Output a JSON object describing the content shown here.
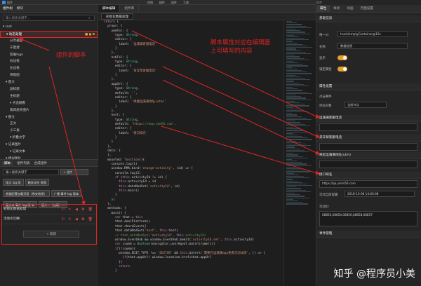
{
  "topbar": {
    "logo_text": "插件",
    "menu": [
      "在线",
      "插件",
      "组件",
      "工具"
    ],
    "right_text": "同步"
  },
  "left": {
    "tabs": [
      "组件树",
      "模块"
    ],
    "search_placeholder": "输入搜索关键字...",
    "tree": [
      {
        "label": "▾ root",
        "indent": 0
      },
      {
        "label": "▾ 动态处理",
        "indent": 4,
        "selected": true
      },
      {
        "label": "分享截图",
        "indent": 10
      },
      {
        "label": "宁夏建",
        "indent": 10
      },
      {
        "label": "巡展logo",
        "indent": 10
      },
      {
        "label": "右边框",
        "indent": 10
      },
      {
        "label": "左边框",
        "indent": 10
      },
      {
        "label": "弹窗图",
        "indent": 10
      },
      {
        "label": "▾ 图文",
        "indent": 4
      },
      {
        "label": "副标题",
        "indent": 10
      },
      {
        "label": "主标题",
        "indent": 10
      },
      {
        "label": "▾ 点击翻看",
        "indent": 10
      },
      {
        "label": "第四层天图片",
        "indent": 10
      },
      {
        "label": "▾ 图文",
        "indent": 4
      },
      {
        "label": "正文",
        "indent": 10
      },
      {
        "label": "小三角",
        "indent": 10
      },
      {
        "label": "▾ 折叠文字",
        "indent": 10
      },
      {
        "label": "▾ 记录图片",
        "indent": 4
      },
      {
        "label": "▾ 记录文本",
        "indent": 10
      },
      {
        "label": "▾ 相似图片",
        "indent": 4
      }
    ]
  },
  "leftbottom": {
    "tabs": [
      "脚本",
      "组件列表",
      "合成组件"
    ],
    "search_placeholder": "输入搜索关键字",
    "add_label": "+ 组件",
    "chips": [
      "埋点 log 版",
      "触发动作 视频",
      "根据配置加载页面（带安装版）",
      "广播 事件 log 版本",
      "富文本 事件 log 版 本",
      "图片...（加载）..."
    ],
    "scripts": [
      {
        "label": "初始化数据处理"
      },
      {
        "label": "活动ID切换"
      }
    ],
    "new_label": "+ 新建"
  },
  "editor": {
    "tabs": [
      "脚本编辑",
      "组件库"
    ],
    "subtab": "初始化数据处理",
    "code": [
      "return {",
      "  props: {",
      "    ymmTel: {",
      "      type: String,",
      "      editor: {",
      "        label: '运满满客服电话'",
      "      }",
      "    },",
      "    hcbTel: {",
      "      type: String,",
      "      editor: {",
      "        label: '货车帮客服电话'",
      "      }",
      "    },",
      "    appUrl: {",
      "      type: String,",
      "      default: '',",
      "      editor: {",
      "        label: '唤醒运满满地址(utm)'",
      "      }",
      "    },",
      "    host: {",
      "      type: String,",
      "      default: 'https://www.ymm56.com',",
      "      editor: {",
      "        label: '接口域名'",
      "      }",
      "    }",
      "  },",
      "  data: {",
      "  },",
      "  mounted: function(){",
      "    console.log(1)",
      "    window.RMA.bind('change-activity', (id) => {",
      "      console.log(2)",
      "      if (this.activityId != id) {",
      "        this.activityId = id",
      "        this.dataModSet('activityId', id)",
      "        this.main()",
      "      }",
      "    })",
      "  },",
      "  methods: {",
      "    main() {",
      "      var that = this",
      "      that.dealPlatform()",
      "      that.shareEvent()",
      "      that.dataModSet('host', this.host)",
      "      // that.dataModSet('activityId', this.activityId)",
      "      window.EventHub && window.EventHub.$emit('activityId.set', this.activityId)",
      "      var isymm = Boolean(navigator.userAgent.match(/ymm/i))",
      "      if(!isymm){",
      "        window.EDIT_TYPE !== 'EDITOR' && this.$alert('需要在运满满app查看活动详情', () => {",
      "          if(that.appUrl) window.location.href=that.appUrl",
      "        })",
      "        return",
      "      }"
    ]
  },
  "right": {
    "tabs": [
      "属性",
      "样式",
      "动画",
      "页面设置"
    ],
    "basic_title": "基础信息",
    "id_label": "唯一id",
    "id_value": "truck/emptyContainer@10c",
    "name_label": "名称",
    "name_value": "数据处理",
    "show_label": "显示",
    "lock_label": "锁定属性",
    "attr_title": "属性设置",
    "click_label": "点击事件",
    "click_sub_label": "目标对象",
    "click_value": "当前节点",
    "ymm_tel_label": "运满满客服电话",
    "hcb_tel_label": "货车帮客服电话",
    "app_url_label": "唤起运满满地址(utm)",
    "host_label": "接口域名",
    "host_value": "https://qa.ymm56.com",
    "time_label": "活动当前配置",
    "time_value": "2018-10-08 14:00:08",
    "activity_label": "活动ID",
    "activity_value": "08850,08854,08856,08858,08857",
    "event_title": "事件管理"
  },
  "annotations": {
    "component_script": "组件的脚本",
    "props_note_line1": "脚本属性对应在编辑器",
    "props_note_line2": "上可填写的内容"
  },
  "watermark": "知乎 @程序员小美",
  "colors": {
    "annotation_red": "#e02424",
    "toggle_orange": "#e79f2a"
  }
}
